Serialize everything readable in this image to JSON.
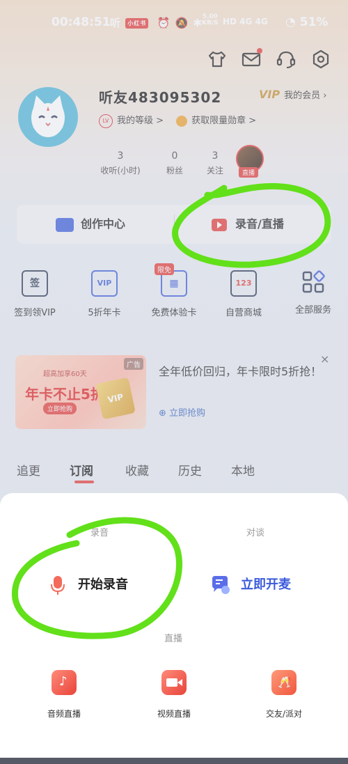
{
  "status_bar": {
    "time": "00:48:51",
    "app_icons": "听",
    "app_pill": "小红书",
    "net_speed": "5.00",
    "net_unit": "KB/S",
    "indicators": "HD  4G  4G",
    "battery": "51%"
  },
  "header_icons": [
    "shirt-icon",
    "mail-icon",
    "headset-icon",
    "settings-icon"
  ],
  "profile": {
    "username": "听友483095302",
    "vip_badge": "VIP",
    "vip_label": "我的会员",
    "level_badge": "LV",
    "level_label": "我的等级 >",
    "medal_label": "获取限量勋章 >",
    "stats": [
      {
        "value": "3",
        "label": "收听(小时)"
      },
      {
        "value": "0",
        "label": "粉丝"
      },
      {
        "value": "3",
        "label": "关注"
      }
    ],
    "live_tag": "直播"
  },
  "creator": {
    "left_label": "创作中心",
    "right_label": "录音/直播"
  },
  "services": [
    {
      "icon": "checkin-icon",
      "icon_text": "签",
      "label": "签到领VIP"
    },
    {
      "icon": "vip-card-icon",
      "icon_text": "VIP",
      "label": "5折年卡"
    },
    {
      "icon": "free-trial-icon",
      "icon_text": "▦",
      "label": "免费体验卡",
      "badge": "限免"
    },
    {
      "icon": "shop-cart-icon",
      "icon_text": "123",
      "label": "自营商城"
    },
    {
      "icon": "all-services-icon",
      "icon_text": "◼",
      "label": "全部服务"
    }
  ],
  "ad": {
    "tag": "广告",
    "line1": "超高加享60天",
    "line2": "年卡不止5折",
    "line3": "立即抢购",
    "card_text": "VIP",
    "headline": "全年低价回归，年卡限时5折抢！",
    "link": "立即抢购",
    "close": "×"
  },
  "tabs": [
    "追更",
    "订阅",
    "收藏",
    "历史",
    "本地"
  ],
  "active_tab": "订阅",
  "sheet": {
    "section_record": "录音",
    "section_chat": "对谈",
    "start_record": "开始录音",
    "start_mic": "立即开麦",
    "section_live": "直播",
    "live_options": [
      {
        "icon": "audio-live-icon",
        "label": "音频直播"
      },
      {
        "icon": "video-live-icon",
        "label": "视频直播"
      },
      {
        "icon": "party-live-icon",
        "label": "交友/派对"
      }
    ]
  },
  "colors": {
    "accent": "#e53935",
    "annotation_green": "#62e01a",
    "link_blue": "#2f5fbf",
    "vip_gold": "#c8902e"
  }
}
